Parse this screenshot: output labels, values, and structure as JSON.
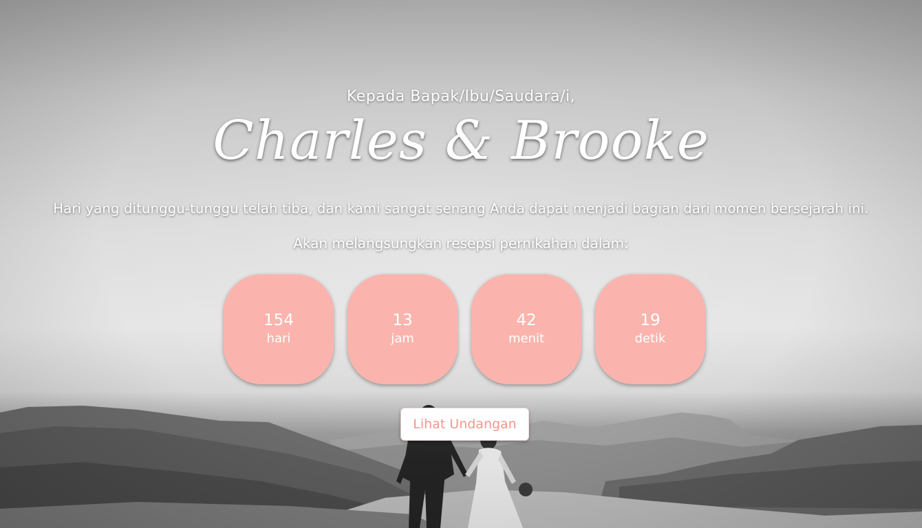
{
  "greeting": "Kepada Bapak/Ibu/Saudara/i,",
  "couple_names": "Charles & Brooke",
  "message": "Hari yang ditunggu-tunggu telah tiba, dan kami sangat senang Anda dapat menjadi bagian dari momen bersejarah ini.",
  "countdown_intro": "Akan melangsungkan resepsi pernikahan dalam:",
  "countdown": [
    {
      "value": "154",
      "label": "hari"
    },
    {
      "value": "13",
      "label": "jam"
    },
    {
      "value": "42",
      "label": "menit"
    },
    {
      "value": "19",
      "label": "detik"
    }
  ],
  "cta_label": "Lihat Undangan",
  "colors": {
    "accent": "#fbb4ad",
    "button_text": "#f5968d",
    "text": "#ffffff"
  }
}
